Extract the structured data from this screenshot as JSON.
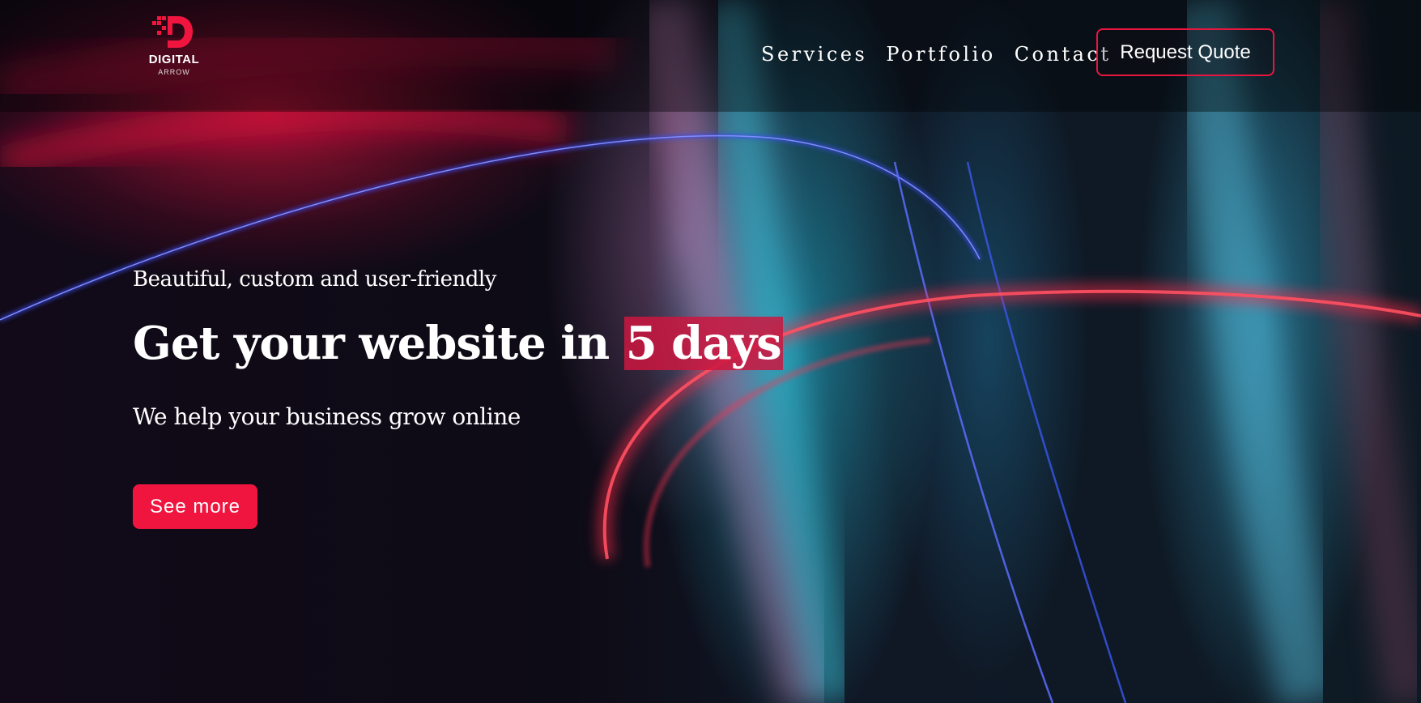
{
  "brand": {
    "name": "DIGITAL",
    "sub": "ARROW",
    "accent_color": "#f0153f"
  },
  "nav": {
    "items": [
      {
        "label": "Services"
      },
      {
        "label": "Portfolio"
      },
      {
        "label": "Contact"
      }
    ],
    "cta_label": "Request Quote"
  },
  "hero": {
    "tagline": "Beautiful, custom and user-friendly",
    "headline_prefix": "Get your website in ",
    "headline_highlight": "5 days",
    "subheading": "We help your business grow online",
    "cta_label": "See more"
  },
  "background": {
    "description_icon": "light-trails-image"
  }
}
